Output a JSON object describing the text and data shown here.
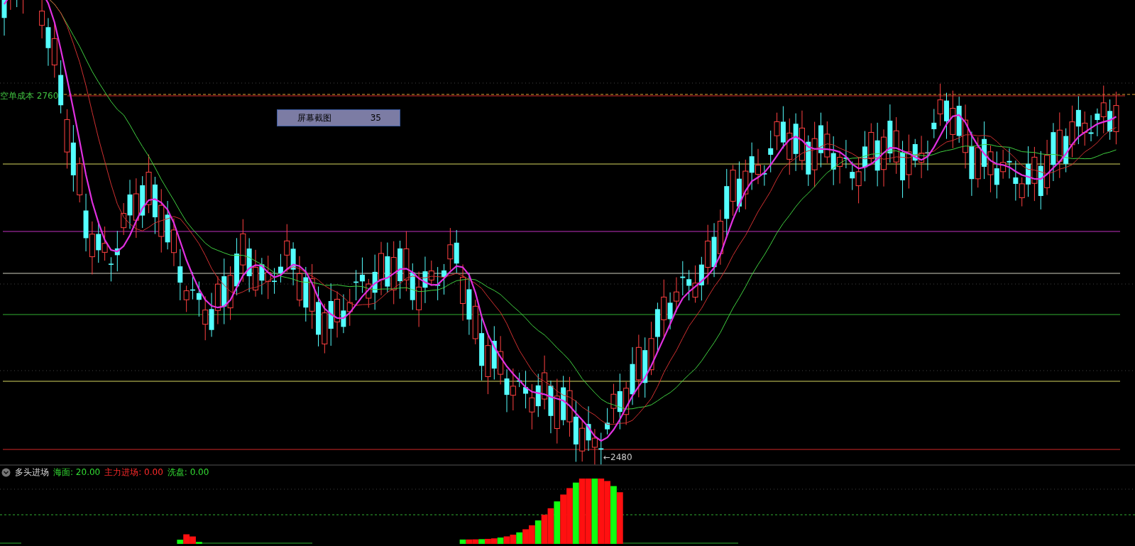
{
  "price_chart": {
    "cost_label": "空单成本 2760",
    "low_label": "←2480"
  },
  "popup": {
    "title": "屏幕截图",
    "value": "35"
  },
  "indicator": {
    "name": "多头进场",
    "values": [
      {
        "label": "海面: 20.00",
        "color": "#33dd33"
      },
      {
        "label": "主力进场: 0.00",
        "color": "#ff2a2a"
      },
      {
        "label": "洗盘: 0.00",
        "color": "#33dd33"
      }
    ]
  }
}
